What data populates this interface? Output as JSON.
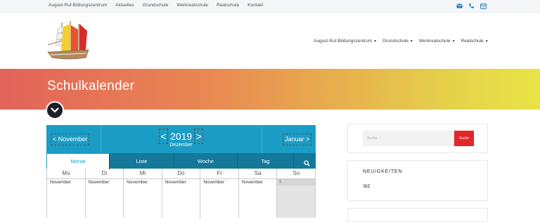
{
  "topbar": {
    "links": [
      "August-Ruf-Bildungszentrum",
      "Aktuelles",
      "Grundschule",
      "Werkrealschule",
      "Realschule",
      "Kontakt"
    ],
    "icons": [
      "envelope-icon",
      "phone-icon",
      "mail-outline-icon"
    ]
  },
  "mainnav": [
    {
      "label": "August-Ruf-Bildungszentrum"
    },
    {
      "label": "Grundschule"
    },
    {
      "label": "Werkrealschule"
    },
    {
      "label": "Realschule"
    }
  ],
  "banner": {
    "title": "Schulkalender"
  },
  "calendar": {
    "prev": "< November",
    "next": "Januar >",
    "prev_year": "<",
    "next_year": ">",
    "year": "2019",
    "month": "Dezember",
    "tabs": [
      "Monat",
      "Liste",
      "Woche",
      "Tag"
    ],
    "weekdays": [
      "Mo",
      "Di",
      "Mi",
      "Do",
      "Fr",
      "Sa",
      "So"
    ],
    "cells": [
      "November",
      "November",
      "November",
      "November",
      "November",
      "November",
      "1"
    ]
  },
  "sidebar": {
    "search_placeholder": "Suche",
    "search_button": "Suche",
    "news_title": "NEUIGKEITEN",
    "news_item": "BIZ"
  },
  "colors": {
    "accent": "#1b9cc4",
    "tabs_bg": "#14789a",
    "search_button": "#e3262a"
  }
}
